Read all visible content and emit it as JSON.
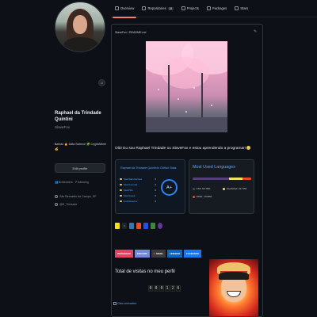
{
  "tabs": [
    {
      "label": "Overview",
      "icon": "book-icon",
      "active": true
    },
    {
      "label": "Repositories",
      "icon": "repo-icon",
      "count": "18"
    },
    {
      "label": "Projects",
      "icon": "project-icon"
    },
    {
      "label": "Packages",
      "icon": "package-icon"
    },
    {
      "label": "Stars",
      "icon": "star-icon"
    }
  ],
  "profile": {
    "name": "Raphael da Trindade Quintini",
    "login": "SlaveFox",
    "bio": "Bahiáo 🔥 Data Science 🧩 CryptoMiner 💰",
    "edit_label": "Edit profile",
    "followers": "6",
    "followers_label": "followers",
    "following": "7",
    "following_label": "following",
    "location": "São Bernardo do Campo, SP",
    "twitter": "@R_Trindade"
  },
  "readme": {
    "path": "SlaveFox / README.md",
    "greeting": "Olá! Eu sou Raphael Trindade ou SlaveFox e estou aprendendo a programar!",
    "stats": {
      "title": "Raphael da Trindade Quintini's GitHub Stats",
      "rows": [
        {
          "label": "Total Stars Earned:",
          "value": "0"
        },
        {
          "label": "Total Commits:",
          "value": "0"
        },
        {
          "label": "Total PRs:",
          "value": "0"
        },
        {
          "label": "Total Issues:",
          "value": "0"
        },
        {
          "label": "Contributed to:",
          "value": "0"
        }
      ],
      "rank": "A+"
    },
    "languages": {
      "title": "Most Used Languages",
      "items": [
        {
          "name": "CSS",
          "percent": "62.79%",
          "color": "#563d7c",
          "fraction": 0.6279
        },
        {
          "name": "JavaScript",
          "percent": "22.73%",
          "color": "#f1e05a",
          "fraction": 0.2273
        },
        {
          "name": "HTML",
          "percent": "13.99%",
          "color": "#e34c26",
          "fraction": 0.1399
        }
      ]
    },
    "badges": [
      {
        "label": "INSTAGRAM",
        "color": "#e4405f"
      },
      {
        "label": "DISCORD",
        "color": "#7289da"
      },
      {
        "label": "GMAIL",
        "color": "#3a3a3a"
      },
      {
        "label": "LINKEDIN",
        "color": "#0a66c2"
      },
      {
        "label": "FACEBOOK",
        "color": "#1877f2"
      }
    ],
    "visits_title": "Total de visitas no meu perfil",
    "visits_digits": [
      "0",
      "0",
      "0",
      "1",
      "2",
      "6"
    ],
    "gif_alt": "Gato animation"
  }
}
